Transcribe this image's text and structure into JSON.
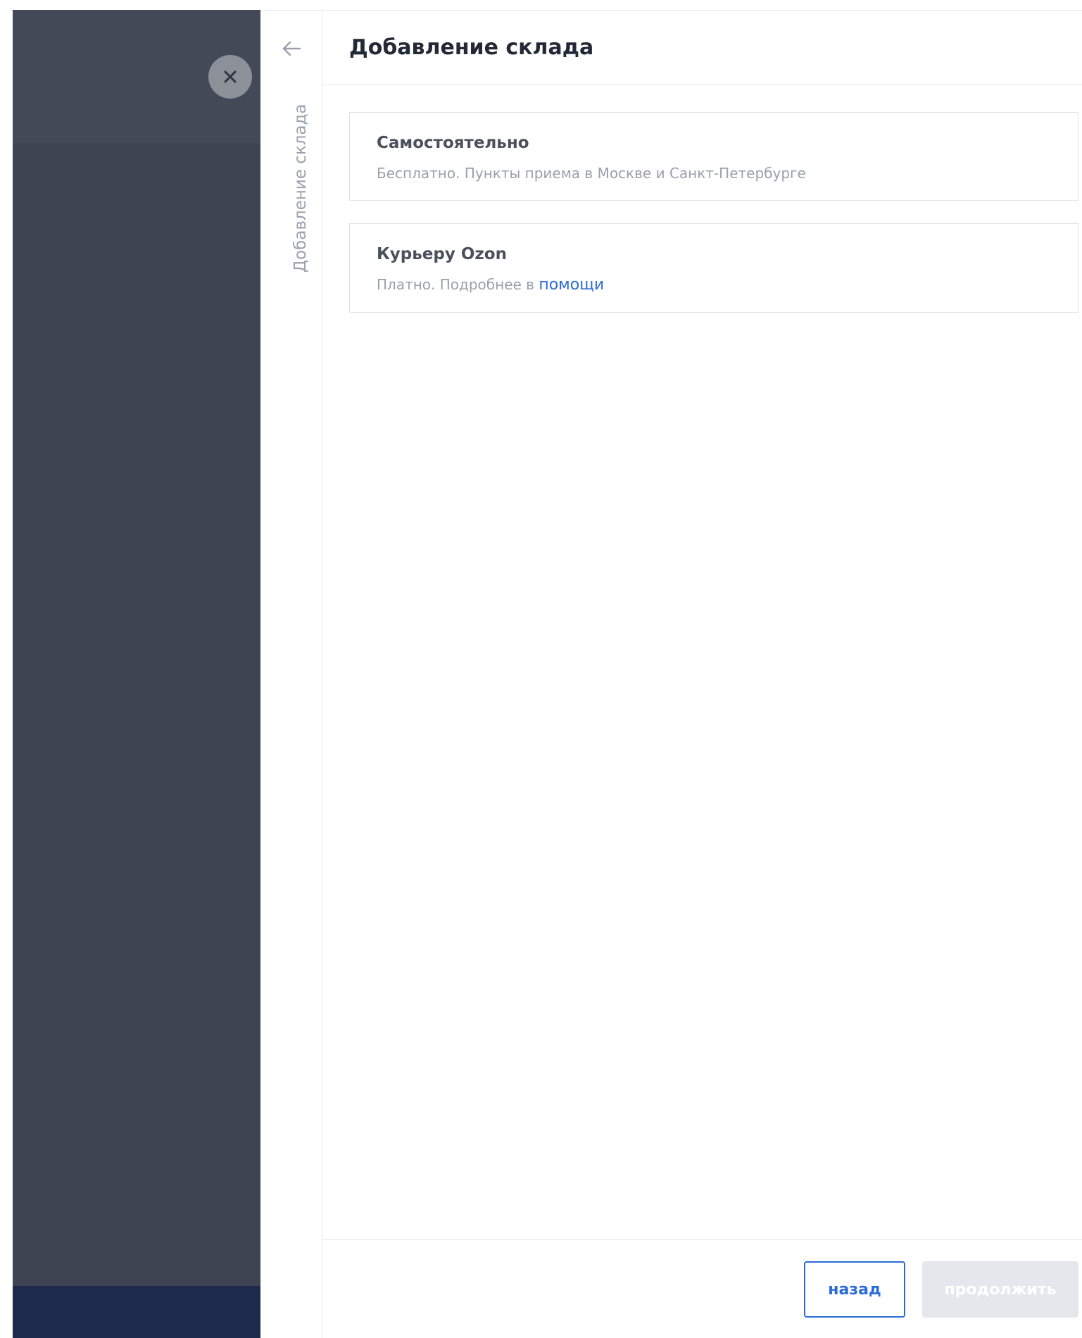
{
  "panel": {
    "rail_label": "Добавление склада",
    "title": "Добавление склада"
  },
  "options": [
    {
      "title": "Самостоятельно",
      "description": "Бесплатно. Пункты приема в Москве и Санкт-Петербурге"
    },
    {
      "title": "Курьеру Ozon",
      "description_prefix": "Платно. Подробнее в ",
      "link_text": "помощи"
    }
  ],
  "footer": {
    "back_label": "назад",
    "next_label": "продолжить"
  },
  "icons": {
    "close": "close-icon",
    "back": "arrow-left-icon"
  },
  "colors": {
    "accent": "#2b6bd6",
    "overlay": "#3d4350",
    "disabled": "#e4e7eb"
  }
}
